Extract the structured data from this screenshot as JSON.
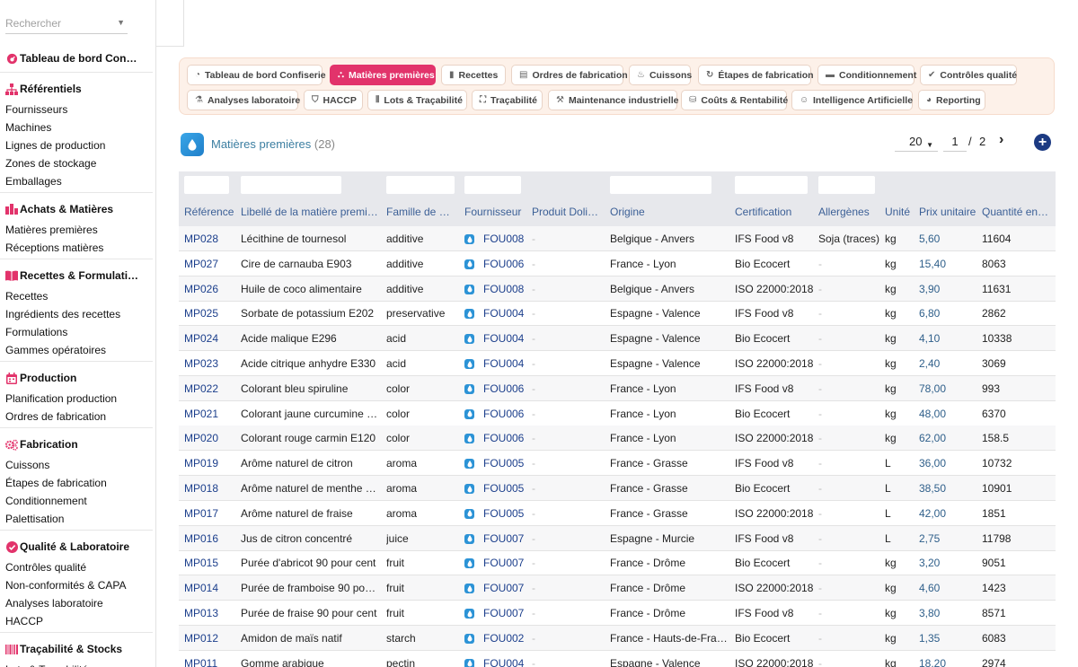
{
  "search": {
    "placeholder": "Rechercher"
  },
  "sidebar": {
    "sections": [
      {
        "title": "Tableau de bord Con…",
        "icon": "dashboard-gauge-icon",
        "items": []
      },
      {
        "title": "Référentiels",
        "icon": "hierarchy-icon",
        "items": [
          "Fournisseurs",
          "Machines",
          "Lignes de production",
          "Zones de stockage",
          "Emballages"
        ]
      },
      {
        "title": "Achats & Matières",
        "icon": "warehouse-icon",
        "items": [
          "Matières premières",
          "Réceptions matières"
        ]
      },
      {
        "title": "Recettes & Formulati…",
        "icon": "book-icon",
        "items": [
          "Recettes",
          "Ingrédients des recettes",
          "Formulations",
          "Gammes opératoires"
        ]
      },
      {
        "title": "Production",
        "icon": "calendar-icon",
        "items": [
          "Planification production",
          "Ordres de fabrication"
        ]
      },
      {
        "title": "Fabrication",
        "icon": "cogs-icon",
        "items": [
          "Cuissons",
          "Étapes de fabrication",
          "Conditionnement",
          "Palettisation"
        ]
      },
      {
        "title": "Qualité & Laboratoire",
        "icon": "check-circle-icon",
        "items": [
          "Contrôles qualité",
          "Non-conformités & CAPA",
          "Analyses laboratoire",
          "HACCP"
        ]
      },
      {
        "title": "Traçabilité & Stocks",
        "icon": "barcode-icon",
        "items": [
          "Lots & Traçabilité"
        ]
      }
    ]
  },
  "tabs": [
    {
      "label": "Tableau de bord Confiserie",
      "icon": "dashboard-gauge-icon",
      "glyph": "◔"
    },
    {
      "label": "Matières premières",
      "icon": "hierarchy-icon",
      "glyph": "⛬",
      "active": true
    },
    {
      "label": "Recettes",
      "icon": "book-icon",
      "glyph": "▮"
    },
    {
      "label": "Ordres de fabrication",
      "icon": "file-icon",
      "glyph": "▤"
    },
    {
      "label": "Cuissons",
      "icon": "fire-icon",
      "glyph": "♨"
    },
    {
      "label": "Étapes de fabrication",
      "icon": "sync-icon",
      "glyph": "↻"
    },
    {
      "label": "Conditionnement",
      "icon": "box-icon",
      "glyph": "▬"
    },
    {
      "label": "Contrôles qualité",
      "icon": "check-circle-icon",
      "glyph": "✔"
    },
    {
      "label": "Analyses laboratoire",
      "icon": "flask-icon",
      "glyph": "⚗"
    },
    {
      "label": "HACCP",
      "icon": "shield-icon",
      "glyph": "⛉"
    },
    {
      "label": "Lots & Traçabilité",
      "icon": "barcode-icon",
      "glyph": "⦀"
    },
    {
      "label": "Traçabilité",
      "icon": "sitemap-icon",
      "glyph": "⛶"
    },
    {
      "label": "Maintenance industrielle",
      "icon": "wrench-icon",
      "glyph": "⚒"
    },
    {
      "label": "Coûts & Rentabilité",
      "icon": "coins-icon",
      "glyph": "⛁"
    },
    {
      "label": "Intelligence Artificielle",
      "icon": "robot-icon",
      "glyph": "☺"
    },
    {
      "label": "Reporting",
      "icon": "chart-pie-icon",
      "glyph": "◕"
    }
  ],
  "page": {
    "title": "Matières premières",
    "count": "(28)",
    "page_size": "20",
    "page_current": "1",
    "page_sep": "/",
    "page_total": "2",
    "next_glyph": "›",
    "add_glyph": "+"
  },
  "table": {
    "headers": [
      "Référence",
      "Libellé de la matière première",
      "Famille de m…",
      "Fournisseur",
      "Produit Dolib…",
      "Origine",
      "Certification",
      "Allergènes",
      "Unité",
      "Prix unitaire",
      "Quantité en …"
    ],
    "rows": [
      [
        "MP028",
        "Lécithine de tournesol",
        "additive",
        "FOU008",
        "-",
        "Belgique - Anvers",
        "IFS Food v8",
        "Soja (traces)",
        "kg",
        "5,60",
        "11604"
      ],
      [
        "MP027",
        "Cire de carnauba E903",
        "additive",
        "FOU006",
        "-",
        "France - Lyon",
        "Bio Ecocert",
        "-",
        "kg",
        "15,40",
        "8063"
      ],
      [
        "MP026",
        "Huile de coco alimentaire",
        "additive",
        "FOU008",
        "-",
        "Belgique - Anvers",
        "ISO 22000:2018",
        "-",
        "kg",
        "3,90",
        "11631"
      ],
      [
        "MP025",
        "Sorbate de potassium E202",
        "preservative",
        "FOU004",
        "-",
        "Espagne - Valence",
        "IFS Food v8",
        "-",
        "kg",
        "6,80",
        "2862"
      ],
      [
        "MP024",
        "Acide malique E296",
        "acid",
        "FOU004",
        "-",
        "Espagne - Valence",
        "Bio Ecocert",
        "-",
        "kg",
        "4,10",
        "10338"
      ],
      [
        "MP023",
        "Acide citrique anhydre E330",
        "acid",
        "FOU004",
        "-",
        "Espagne - Valence",
        "ISO 22000:2018",
        "-",
        "kg",
        "2,40",
        "3069"
      ],
      [
        "MP022",
        "Colorant bleu spiruline",
        "color",
        "FOU006",
        "-",
        "France - Lyon",
        "IFS Food v8",
        "-",
        "kg",
        "78,00",
        "993"
      ],
      [
        "MP021",
        "Colorant jaune curcumine E…",
        "color",
        "FOU006",
        "-",
        "France - Lyon",
        "Bio Ecocert",
        "-",
        "kg",
        "48,00",
        "6370"
      ],
      [
        "MP020",
        "Colorant rouge carmin E120",
        "color",
        "FOU006",
        "-",
        "France - Lyon",
        "ISO 22000:2018",
        "-",
        "kg",
        "62,00",
        "158.5"
      ],
      [
        "MP019",
        "Arôme naturel de citron",
        "aroma",
        "FOU005",
        "-",
        "France - Grasse",
        "IFS Food v8",
        "-",
        "L",
        "36,00",
        "10732"
      ],
      [
        "MP018",
        "Arôme naturel de menthe p…",
        "aroma",
        "FOU005",
        "-",
        "France - Grasse",
        "Bio Ecocert",
        "-",
        "L",
        "38,50",
        "10901"
      ],
      [
        "MP017",
        "Arôme naturel de fraise",
        "aroma",
        "FOU005",
        "-",
        "France - Grasse",
        "ISO 22000:2018",
        "-",
        "L",
        "42,00",
        "1851"
      ],
      [
        "MP016",
        "Jus de citron concentré",
        "juice",
        "FOU007",
        "-",
        "Espagne - Murcie",
        "IFS Food v8",
        "-",
        "L",
        "2,75",
        "11798"
      ],
      [
        "MP015",
        "Purée d'abricot 90 pour cent",
        "fruit",
        "FOU007",
        "-",
        "France - Drôme",
        "Bio Ecocert",
        "-",
        "kg",
        "3,20",
        "9051"
      ],
      [
        "MP014",
        "Purée de framboise 90 pour…",
        "fruit",
        "FOU007",
        "-",
        "France - Drôme",
        "ISO 22000:2018",
        "-",
        "kg",
        "4,60",
        "1423"
      ],
      [
        "MP013",
        "Purée de fraise 90 pour cent",
        "fruit",
        "FOU007",
        "-",
        "France - Drôme",
        "IFS Food v8",
        "-",
        "kg",
        "3,80",
        "8571"
      ],
      [
        "MP012",
        "Amidon de maïs natif",
        "starch",
        "FOU002",
        "-",
        "France - Hauts-de-France",
        "Bio Ecocert",
        "-",
        "kg",
        "1,35",
        "6083"
      ],
      [
        "MP011",
        "Gomme arabique",
        "pectin",
        "FOU004",
        "-",
        "Espagne - Valence",
        "ISO 22000:2018",
        "-",
        "kg",
        "18,20",
        "2974"
      ]
    ]
  },
  "colors": {
    "active_tab": "#e2336b",
    "link": "#1c3f8c",
    "header_text": "#3b5f96",
    "accent_icon": "#2c93d6",
    "section_icon": "#e2336b"
  }
}
